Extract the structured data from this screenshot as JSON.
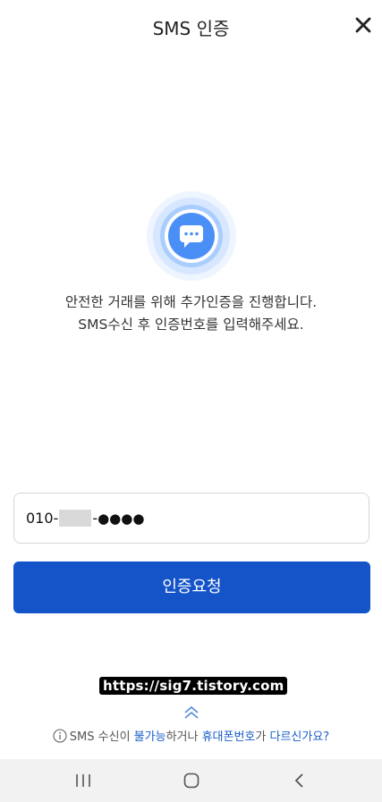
{
  "header": {
    "title": "SMS 인증"
  },
  "message": {
    "line1": "안전한 거래를 위해 추가인증을 진행합니다.",
    "line2": "SMS수신 후 인증번호를 입력해주세요."
  },
  "phone": {
    "prefix": "010-",
    "separator": "-",
    "masked_tail": "●●●●"
  },
  "request_button": {
    "label": "인증요청"
  },
  "watermark": {
    "text": "https://sig7.tistory.com"
  },
  "help": {
    "part1": "SMS 수신이 ",
    "link1": "불가능",
    "part2": "하거나 ",
    "link2": "휴대폰번호",
    "part3": "가 ",
    "link3": "다르신가요?"
  },
  "colors": {
    "accent": "#1554c8",
    "link": "#1a5fc8",
    "icon_blue": "#4a8ff5"
  }
}
